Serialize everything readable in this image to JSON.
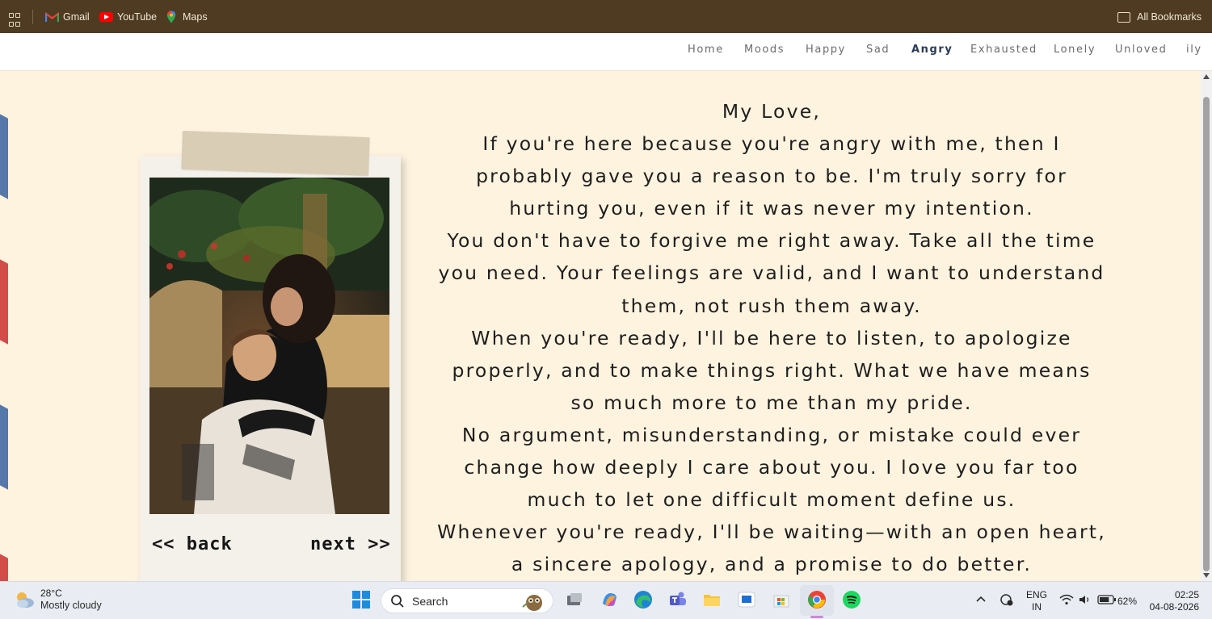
{
  "bookmarks": {
    "items": [
      {
        "label": "Gmail",
        "icon": "gmail-icon"
      },
      {
        "label": "YouTube",
        "icon": "youtube-icon"
      },
      {
        "label": "Maps",
        "icon": "maps-icon"
      }
    ],
    "all_bookmarks": "All Bookmarks"
  },
  "nav": {
    "items": [
      "Home",
      "Moods",
      "Happy",
      "Sad",
      "Angry",
      "Exhausted",
      "Lonely",
      "Unloved",
      "ily"
    ],
    "active": "Angry"
  },
  "letter": {
    "greeting": "My Love,",
    "paragraphs": [
      "If you're here because you're angry with me, then I probably gave you a reason to be. I'm truly sorry for hurting you, even if it was never my intention.",
      "You don't have to forgive me right away. Take all the time you need. Your feelings are valid, and I want to understand them, not rush them away.",
      "When you're ready, I'll be here to listen, to apologize properly, and to make things right. What we have means so much more to me than my pride.",
      "No argument, misunderstanding, or mistake could ever change how deeply I care about you. I love you far too much to let one difficult moment define us.",
      "Whenever you're ready, I'll be waiting—with an open heart, a sincere apology, and a promise to do better."
    ]
  },
  "polaroid": {
    "back_label": "<< back",
    "next_label": "next >>"
  },
  "taskbar": {
    "weather_temp": "28°C",
    "weather_condition": "Mostly cloudy",
    "search_label": "Search",
    "lang_top": "ENG",
    "lang_bottom": "IN",
    "battery": "62%",
    "time": "02:25",
    "date": "04-08-2026"
  },
  "colors": {
    "bookmarks_bg": "#4e3b22",
    "page_bg": "#fdf3df",
    "nav_active": "#2b3a55",
    "stripe_blue": "#5577a9",
    "stripe_red": "#d24d4a"
  }
}
